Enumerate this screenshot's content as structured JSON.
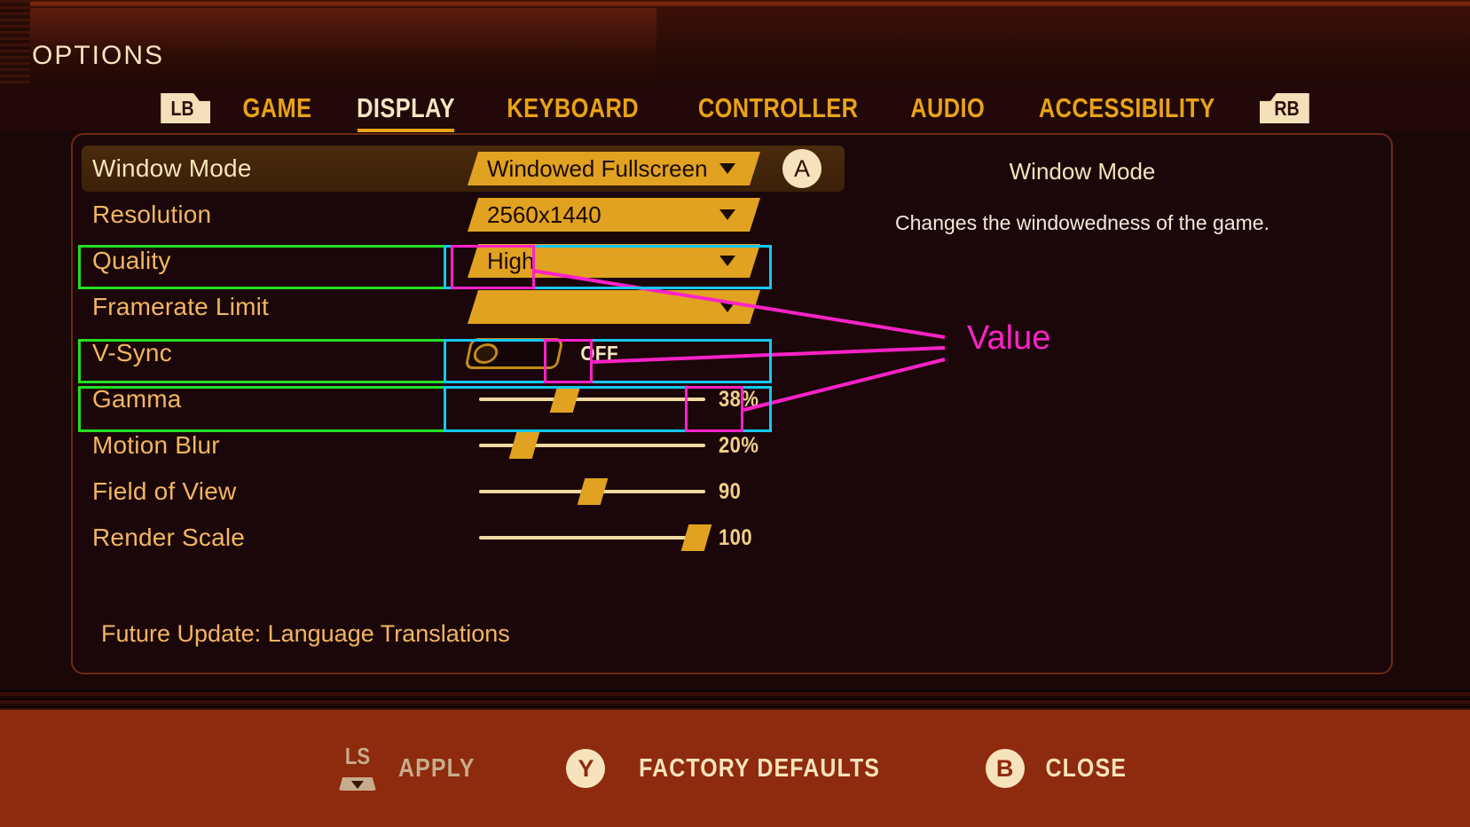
{
  "header": {
    "title": "OPTIONS",
    "bumper_left": "LB",
    "bumper_right": "RB",
    "tabs": [
      {
        "label": "GAME",
        "active": false
      },
      {
        "label": "DISPLAY",
        "active": true
      },
      {
        "label": "KEYBOARD",
        "active": false
      },
      {
        "label": "CONTROLLER",
        "active": false
      },
      {
        "label": "AUDIO",
        "active": false
      },
      {
        "label": "ACCESSIBILITY",
        "active": false
      }
    ]
  },
  "settings": {
    "rows": [
      {
        "label": "Window Mode",
        "type": "dropdown",
        "value": "Windowed Fullscreen",
        "selected": true,
        "confirm_button": "A"
      },
      {
        "label": "Resolution",
        "type": "dropdown",
        "value": "2560x1440",
        "selected": false
      },
      {
        "label": "Quality",
        "type": "dropdown",
        "value": "High",
        "selected": false
      },
      {
        "label": "Framerate Limit",
        "type": "dropdown",
        "value": "",
        "selected": false
      },
      {
        "label": "V-Sync",
        "type": "toggle",
        "value": "OFF",
        "toggle_on": false
      },
      {
        "label": "Gamma",
        "type": "slider",
        "value": "38%",
        "percent": 38
      },
      {
        "label": "Motion Blur",
        "type": "slider",
        "value": "20%",
        "percent": 20
      },
      {
        "label": "Field of View",
        "type": "slider",
        "value": "90",
        "percent": 50
      },
      {
        "label": "Render Scale",
        "type": "slider",
        "value": "100",
        "percent": 96
      }
    ],
    "footer_note": "Future Update: Language Translations"
  },
  "info": {
    "title": "Window Mode",
    "description": "Changes the windowedness of the game."
  },
  "bottom_bar": {
    "actions": [
      {
        "icon": "LS",
        "label": "APPLY",
        "dim": true
      },
      {
        "icon": "Y",
        "label": "FACTORY DEFAULTS",
        "dim": false
      },
      {
        "icon": "B",
        "label": "CLOSE",
        "dim": false
      }
    ]
  },
  "annotations": {
    "label": "Value",
    "colors": {
      "row": "#22e022",
      "control": "#15c8f0",
      "value": "#ff22c8"
    }
  }
}
